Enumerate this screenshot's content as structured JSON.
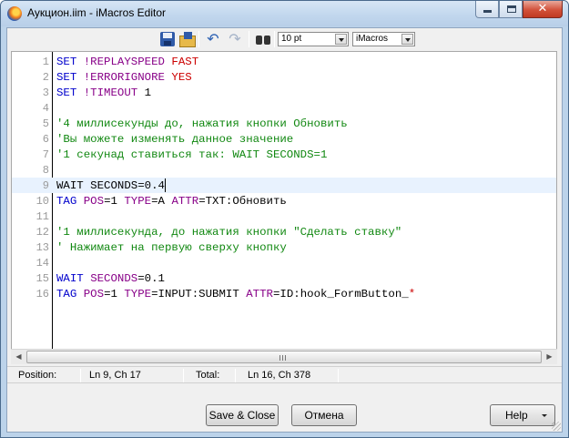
{
  "window": {
    "title": "Аукцион.iim - iMacros Editor"
  },
  "toolbar": {
    "font_size": "10 pt",
    "mode": "iMacros",
    "icons": [
      "save-icon",
      "save-as-icon",
      "undo-icon",
      "redo-icon",
      "find-icon"
    ]
  },
  "editor": {
    "current_line": 9,
    "lines": [
      {
        "num": "1",
        "segments": [
          {
            "t": "SET ",
            "c": "#0000cc"
          },
          {
            "t": "!REPLAYSPEED ",
            "c": "#880088"
          },
          {
            "t": "FAST",
            "c": "#cc0000"
          }
        ]
      },
      {
        "num": "2",
        "segments": [
          {
            "t": "SET ",
            "c": "#0000cc"
          },
          {
            "t": "!ERRORIGNORE ",
            "c": "#880088"
          },
          {
            "t": "YES",
            "c": "#cc0000"
          }
        ]
      },
      {
        "num": "3",
        "segments": [
          {
            "t": "SET ",
            "c": "#0000cc"
          },
          {
            "t": "!TIMEOUT ",
            "c": "#880088"
          },
          {
            "t": "1",
            "c": "#000000"
          }
        ]
      },
      {
        "num": "4",
        "segments": []
      },
      {
        "num": "5",
        "segments": [
          {
            "t": "'4 миллисекунды до, нажатия кнопки Обновить",
            "c": "#118811"
          }
        ]
      },
      {
        "num": "6",
        "segments": [
          {
            "t": "'Вы можете изменять данное значение",
            "c": "#118811"
          }
        ]
      },
      {
        "num": "7",
        "segments": [
          {
            "t": "'1 секунад ставиться так: WAIT SECONDS=1",
            "c": "#118811"
          }
        ]
      },
      {
        "num": "8",
        "segments": []
      },
      {
        "num": "9",
        "segments": [
          {
            "t": "WAIT SECONDS=0.4",
            "c": "#000000"
          }
        ]
      },
      {
        "num": "10",
        "segments": [
          {
            "t": "TAG ",
            "c": "#0000cc"
          },
          {
            "t": "POS",
            "c": "#880088"
          },
          {
            "t": "=1 ",
            "c": "#000000"
          },
          {
            "t": "TYPE",
            "c": "#880088"
          },
          {
            "t": "=A ",
            "c": "#000000"
          },
          {
            "t": "ATTR",
            "c": "#880088"
          },
          {
            "t": "=TXT:Обновить",
            "c": "#000000"
          }
        ]
      },
      {
        "num": "11",
        "segments": []
      },
      {
        "num": "12",
        "segments": [
          {
            "t": "'1 миллисекунда, до нажатия кнопки \"Сделать ставку\"",
            "c": "#118811"
          }
        ]
      },
      {
        "num": "13",
        "segments": [
          {
            "t": "' Нажимает на первую сверху кнопку",
            "c": "#118811"
          }
        ]
      },
      {
        "num": "14",
        "segments": []
      },
      {
        "num": "15",
        "segments": [
          {
            "t": "WAIT ",
            "c": "#0000cc"
          },
          {
            "t": "SECONDS",
            "c": "#880088"
          },
          {
            "t": "=0.1",
            "c": "#000000"
          }
        ]
      },
      {
        "num": "16",
        "segments": [
          {
            "t": "TAG ",
            "c": "#0000cc"
          },
          {
            "t": "POS",
            "c": "#880088"
          },
          {
            "t": "=1 ",
            "c": "#000000"
          },
          {
            "t": "TYPE",
            "c": "#880088"
          },
          {
            "t": "=INPUT:SUBMIT ",
            "c": "#000000"
          },
          {
            "t": "ATTR",
            "c": "#880088"
          },
          {
            "t": "=ID:hook_FormButton_",
            "c": "#000000"
          },
          {
            "t": "*",
            "c": "#cc0000"
          }
        ]
      }
    ]
  },
  "status": {
    "position_label": "Position:",
    "position_value": "Ln 9, Ch 17",
    "total_label": "Total:",
    "total_value": "Ln 16, Ch 378"
  },
  "buttons": {
    "save_close": "Save & Close",
    "cancel": "Отмена",
    "help": "Help"
  }
}
